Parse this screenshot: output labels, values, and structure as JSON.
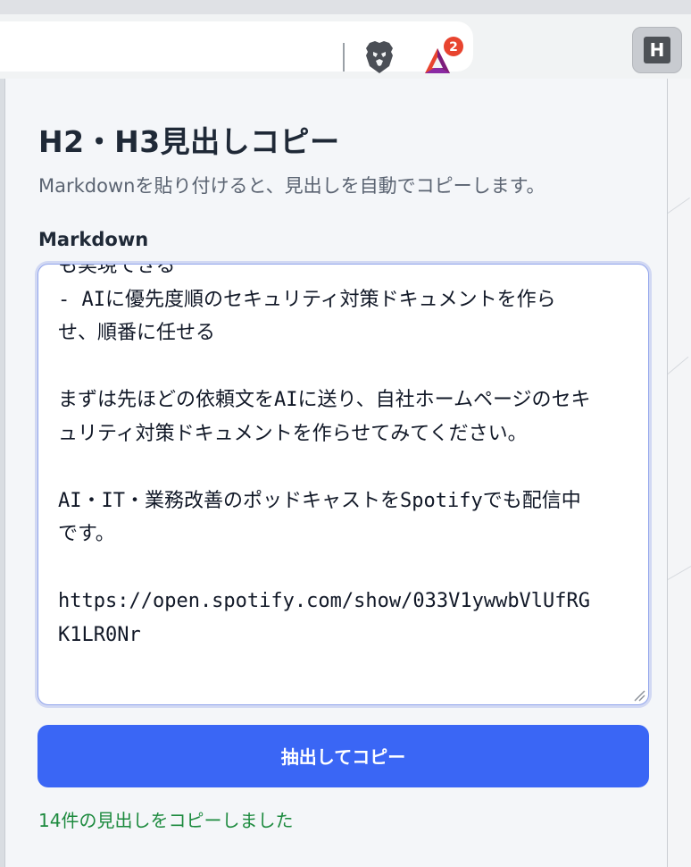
{
  "toolbar": {
    "extension_letter": "H",
    "bat_badge_count": "2",
    "brave_icon": "brave-lion-icon",
    "bat_icon": "bat-rewards-icon"
  },
  "popup": {
    "title": "H2・H3見出しコピー",
    "subtitle": "Markdownを貼り付けると、見出しを自動でコピーします。",
    "field_label": "Markdown",
    "markdown_value": "も実現できる\n- AIに優先度順のセキュリティ対策ドキュメントを作ら\nせ、順番に任せる\n\nまずは先ほどの依頼文をAIに送り、自社ホームページのセキ\nュリティ対策ドキュメントを作らせてみてください。\n\nAI・IT・業務改善のポッドキャストをSpotifyでも配信中\nです。\n\nhttps://open.spotify.com/show/033V1ywwbVlUfRG\nK1LR0Nr",
    "button_label": "抽出してコピー",
    "status_text": "14件の見出しをコピーしました"
  },
  "colors": {
    "accent": "#3a66f5",
    "success": "#1c8a3e",
    "title_text": "#1f2937",
    "muted_text": "#5b6472"
  }
}
